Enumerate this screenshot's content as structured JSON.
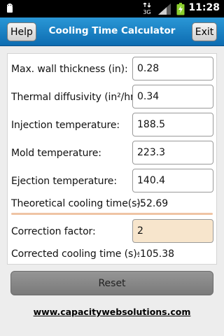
{
  "status_bar": {
    "time": "11:28",
    "icons": [
      "android-usb-icon",
      "mobile-data-icon",
      "signal-icon",
      "battery-charging-icon"
    ],
    "network_label": "3G"
  },
  "title_bar": {
    "title": "Cooling Time Calculator",
    "help_label": "Help",
    "exit_label": "Exit",
    "background_color": "#1a80c4"
  },
  "form": {
    "rows": [
      {
        "label": "Max. wall thickness (in):",
        "value": "0.28"
      },
      {
        "label": "Thermal diffusivity (in²/hr):",
        "value": "0.34"
      },
      {
        "label": "Injection temperature:",
        "value": "188.5"
      },
      {
        "label": "Mold temperature:",
        "value": "223.3"
      },
      {
        "label": "Ejection temperature:",
        "value": "140.4"
      }
    ],
    "theoretical": {
      "label": "Theoretical cooling time(s):",
      "value": "-52.69"
    },
    "correction": {
      "label": "Correction factor:",
      "value": "2",
      "field_color": "#f7e5cc"
    },
    "corrected": {
      "label": "Corrected cooling time (s):",
      "value": "-105.38"
    },
    "divider_color": "#efc4a4"
  },
  "reset_label": "Reset",
  "footer_link": "www.capacitywebsolutions.com"
}
